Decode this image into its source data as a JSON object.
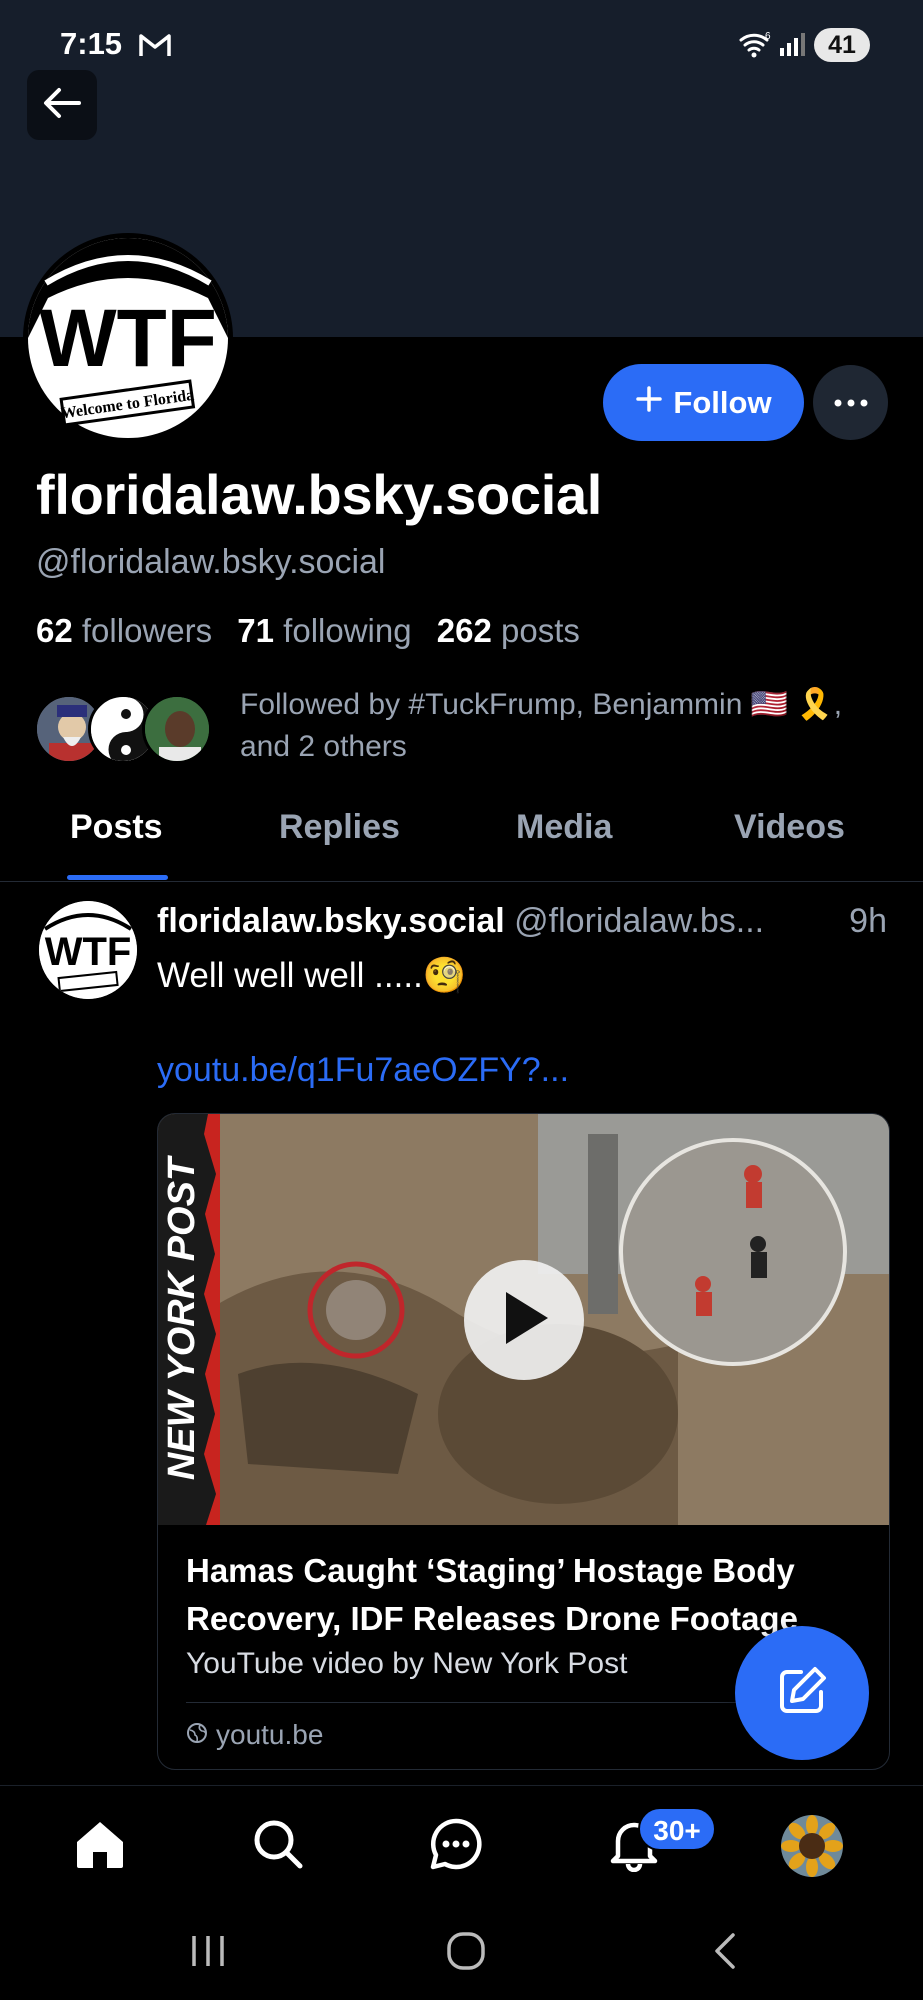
{
  "status_bar": {
    "time": "7:15",
    "battery": "41"
  },
  "profile": {
    "display_name": "floridalaw.bsky.social",
    "handle": "@floridalaw.bsky.social",
    "avatar_text": "WTF",
    "avatar_subtext": "Welcome to Florida",
    "followers_count": "62",
    "followers_label": "followers",
    "following_count": "71",
    "following_label": "following",
    "posts_count": "262",
    "posts_label": "posts",
    "followed_by_text": "Followed by #TuckFrump, Benjammin 🇺🇸 🎗️, and 2 others"
  },
  "actions": {
    "follow_label": "Follow"
  },
  "tabs": [
    {
      "label": "Posts",
      "active": true
    },
    {
      "label": "Replies",
      "active": false
    },
    {
      "label": "Media",
      "active": false
    },
    {
      "label": "Videos",
      "active": false
    }
  ],
  "post": {
    "author": "floridalaw.bsky.social",
    "handle": "@floridalaw.bs...",
    "time": "9h",
    "text": "Well well well .....🧐",
    "link": "youtu.be/q1Fu7aeOZFY?...",
    "embed": {
      "thumbnail_brand": "NEW YORK POST",
      "title": "Hamas Caught ‘Staging’ Hostage Body Recovery, IDF Releases Drone Footage",
      "description": "YouTube video by New York Post",
      "domain": "youtu.be"
    }
  },
  "bottom_nav": {
    "notifications_badge": "30+"
  },
  "colors": {
    "accent": "#2b6cf6",
    "banner": "#161e2b",
    "muted_text": "#9aa4b3",
    "background": "#000000"
  },
  "icons": [
    "back-arrow-icon",
    "plus-icon",
    "ellipsis-icon",
    "play-icon",
    "globe-icon",
    "compose-icon",
    "home-icon",
    "search-icon",
    "chat-icon",
    "bell-icon",
    "gmail-icon",
    "wifi-icon",
    "signal-icon"
  ]
}
